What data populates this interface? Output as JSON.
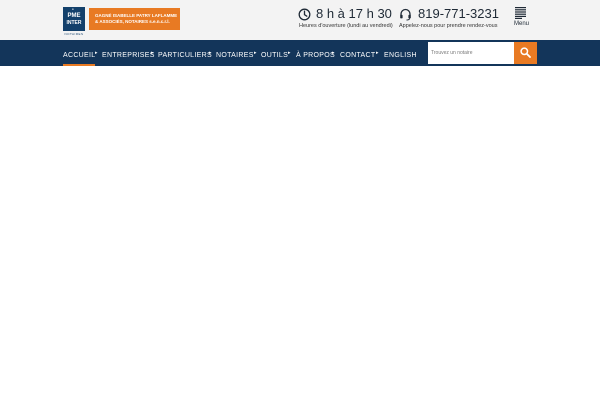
{
  "brand": {
    "logo_line1": "PME",
    "logo_line2": "INTER",
    "logo_sub": "NOTAIRES",
    "firm_line1": "GAGNÉ ISABELLE PATRY LAFLAMME",
    "firm_line2": "& ASSOCIÉS, NOTAIRES s.e.n.c.r.l."
  },
  "contact": {
    "hours": "8 h à 17 h 30",
    "hours_caption": "Heures d'ouverture (lundi au vendredi)",
    "phone": "819-771-3231",
    "phone_caption": "Appelez-nous pour prendre rendez-vous"
  },
  "menu": {
    "label": "Menu"
  },
  "nav": {
    "items": [
      {
        "label": "ACCUEIL",
        "active": true
      },
      {
        "label": "ENTREPRISES",
        "active": false
      },
      {
        "label": "PARTICULIERS",
        "active": false
      },
      {
        "label": "NOTAIRES",
        "active": false
      },
      {
        "label": "OUTILS",
        "active": false
      },
      {
        "label": "À PROPOS",
        "active": false
      },
      {
        "label": "CONTACT",
        "active": false
      },
      {
        "label": "ENGLISH",
        "active": false
      }
    ],
    "separator": "▸"
  },
  "search": {
    "placeholder": "Trouvez un notaire",
    "value": ""
  },
  "colors": {
    "navy": "#13355a",
    "orange": "#e87a23",
    "header_bg": "#f3f3f3"
  },
  "icons": {
    "hours": "clock-icon",
    "phone": "headset-icon",
    "menu": "menu-lines-icon",
    "search": "search-icon"
  }
}
